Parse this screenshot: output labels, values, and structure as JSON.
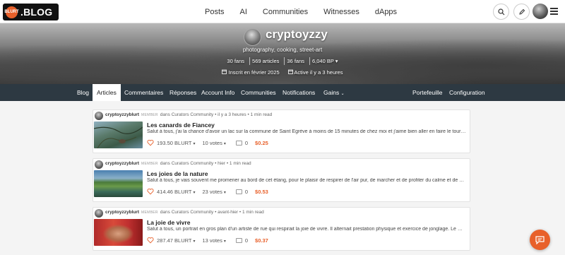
{
  "brand": {
    "logo_text": ".BLOG",
    "badge_text": "BLURT"
  },
  "topnav": [
    "Posts",
    "AI",
    "Communities",
    "Witnesses",
    "dApps"
  ],
  "profile": {
    "name": "cryptoyzzy",
    "about": "photography, cooking, street-art",
    "stats": [
      "30 fans",
      "569 articles",
      "36 fans",
      "6,040 BP ▾"
    ],
    "joined": "Inscrit en février 2025",
    "active": "Active il y a 3 heures"
  },
  "subnav": {
    "left": [
      "Blog",
      "Articles",
      "Commentaires",
      "Réponses",
      "Account Info",
      "Communities",
      "Notifications",
      "Gains"
    ],
    "right": [
      "Portefeuille",
      "Configuration"
    ],
    "active": "Articles"
  },
  "posts": [
    {
      "author": "cryptoyzzyblurt",
      "badge": "MEMBER",
      "community": "dans Curators Community • il y a 3 heures • 1 min read",
      "title": "Les canards de Fiancey",
      "excerpt": "Salut à tous, j'ai la chance d'avoir un lac sur la commune de Saint Egrève à moins de 15 minutes de chez moi et j'aime bien aller en faire le tour…",
      "payout": "193.50 BLURT",
      "votes": "10 votes",
      "comments": "0",
      "value": "$0.25"
    },
    {
      "author": "cryptoyzzyblurt",
      "badge": "MEMBER",
      "community": "dans Curators Community • hier • 1 min read",
      "title": "Les joies de la nature",
      "excerpt": "Salut à tous, je vais souvent me promener au bord de cet étang, pour le plaisir de respirer de l'air pur, de marcher et de profiter du calme et de …",
      "payout": "414.46 BLURT",
      "votes": "23 votes",
      "comments": "0",
      "value": "$0.53"
    },
    {
      "author": "cryptoyzzyblurt",
      "badge": "MEMBER",
      "community": "dans Curators Community • avant-hier • 1 min read",
      "title": "La joie de vivre",
      "excerpt": "Salut à tous, un portrait en gros plan d'un artiste de rue qui respirait la joie de vivre. Il alternait prestation physique et exercice de jonglage. Le …",
      "payout": "287.47 BLURT",
      "votes": "13 votes",
      "comments": "0",
      "value": "$0.37"
    }
  ],
  "colors": {
    "accent": "#e8602a",
    "subnav_bg": "#2d3942"
  }
}
